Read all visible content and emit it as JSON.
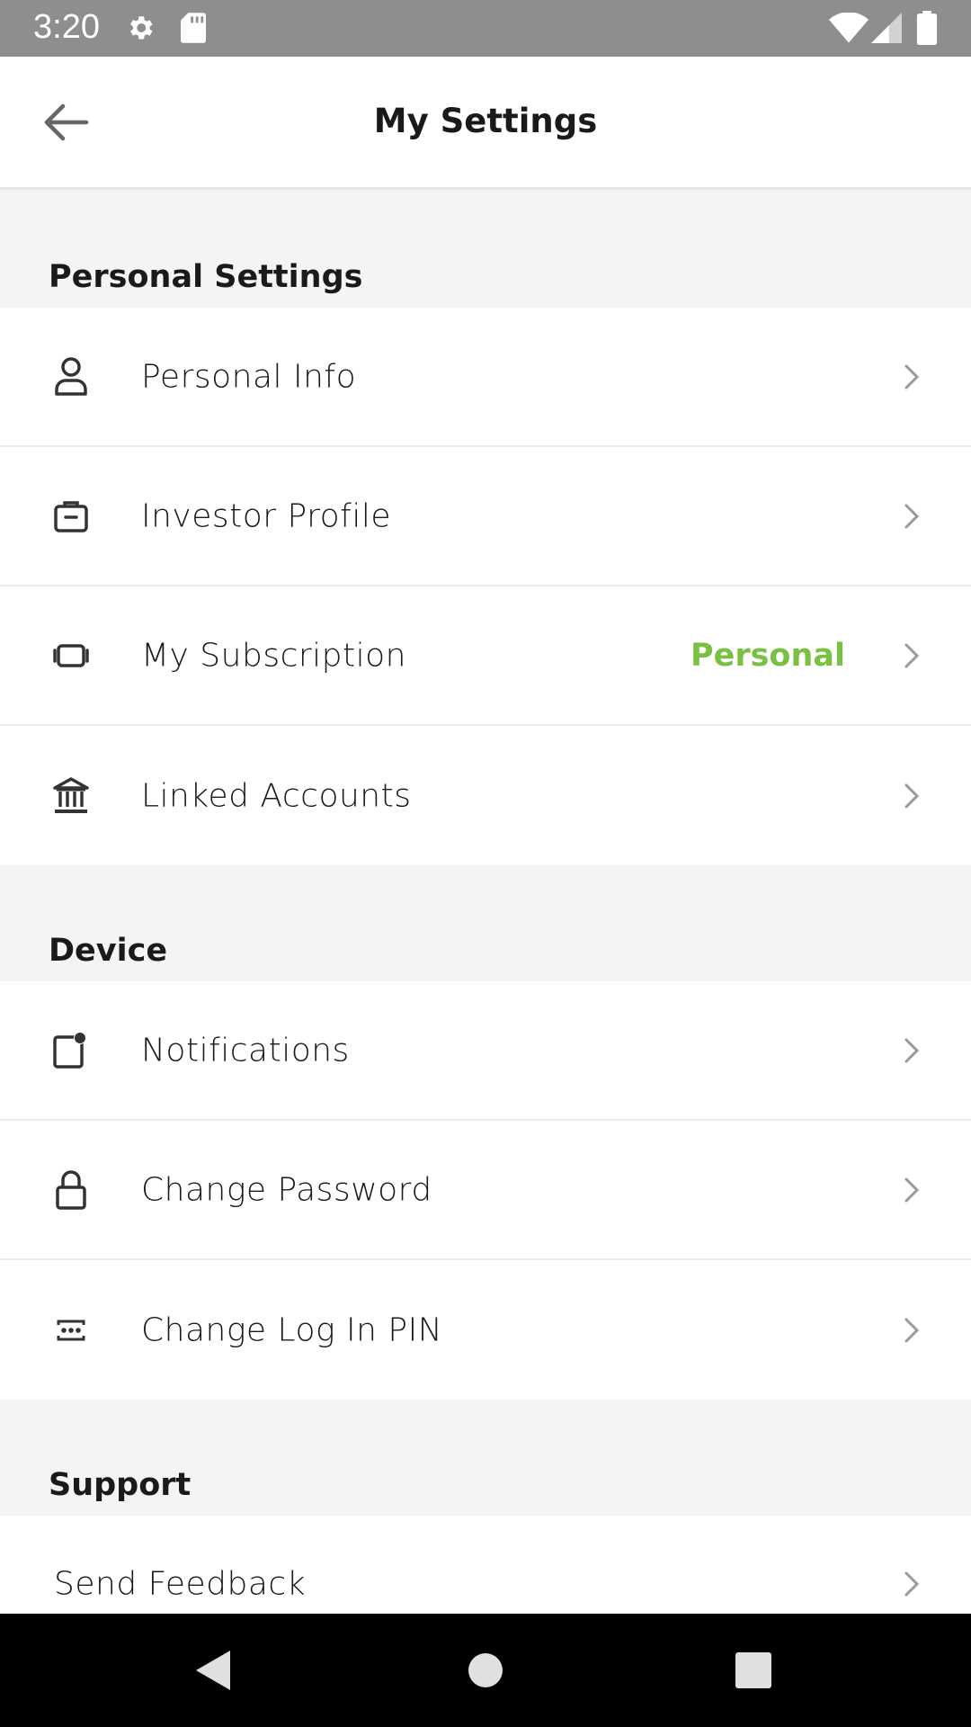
{
  "status_bar": {
    "time": "3:20",
    "icons": [
      "settings-icon",
      "sd-card-icon",
      "wifi-icon",
      "signal-icon",
      "battery-icon"
    ]
  },
  "header": {
    "title": "My Settings",
    "back_icon": "arrow-left-icon"
  },
  "sections": {
    "personal": {
      "title": "Personal Settings",
      "items": [
        {
          "label": "Personal Info",
          "icon": "person-icon"
        },
        {
          "label": "Investor Profile",
          "icon": "briefcase-icon"
        },
        {
          "label": "My Subscription",
          "icon": "subscription-icon",
          "value": "Personal"
        },
        {
          "label": "Linked Accounts",
          "icon": "bank-icon"
        }
      ]
    },
    "device": {
      "title": "Device",
      "items": [
        {
          "label": "Notifications",
          "icon": "notification-icon"
        },
        {
          "label": "Change Password",
          "icon": "lock-icon"
        },
        {
          "label": "Change Log In PIN",
          "icon": "pin-icon"
        }
      ]
    },
    "support": {
      "title": "Support",
      "items": [
        {
          "label": "Send Feedback"
        }
      ]
    }
  },
  "colors": {
    "accent_green": "#7ac143",
    "status_bar": "#8e8e8e",
    "section_bg": "#f4f4f4"
  },
  "nav_bar": {
    "buttons": [
      "back-triangle-icon",
      "home-circle-icon",
      "recents-square-icon"
    ]
  }
}
